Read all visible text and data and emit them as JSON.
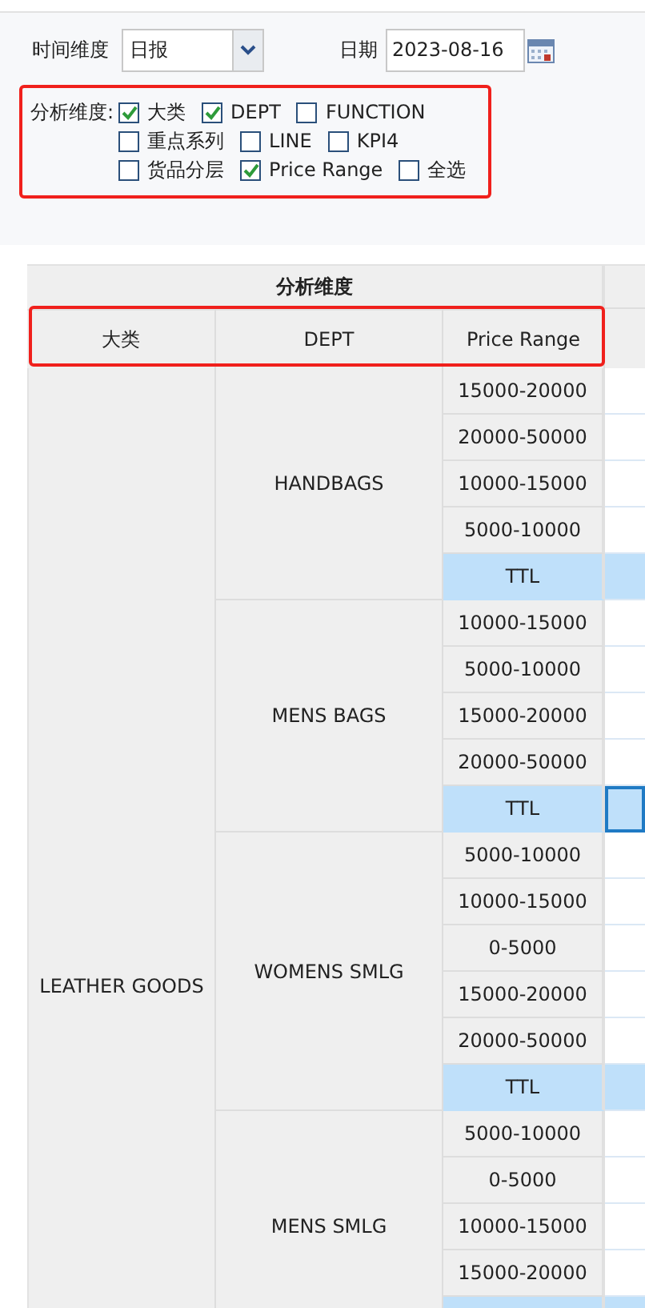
{
  "filters": {
    "period": {
      "label": "时间维度",
      "value": "日报"
    },
    "date": {
      "label": "日期",
      "value": "2023-08-16"
    }
  },
  "dimensions": {
    "label": "分析维度:",
    "option_rows": [
      [
        {
          "label": "大类",
          "checked": true
        },
        {
          "label": "DEPT",
          "checked": true
        },
        {
          "label": "FUNCTION",
          "checked": false
        }
      ],
      [
        {
          "label": "重点系列",
          "checked": false
        },
        {
          "label": "LINE",
          "checked": false
        },
        {
          "label": "KPI4",
          "checked": false
        }
      ],
      [
        {
          "label": "货品分层",
          "checked": false
        },
        {
          "label": "Price Range",
          "checked": true
        },
        {
          "label": "全选",
          "checked": false
        }
      ]
    ]
  },
  "table": {
    "group_header": "分析维度",
    "columns": [
      "大类",
      "DEPT",
      "Price Range"
    ],
    "category": "LEATHER GOODS",
    "depts": [
      {
        "name": "HANDBAGS",
        "ranges": [
          {
            "label": "15000-20000",
            "kind": "range",
            "selected": false
          },
          {
            "label": "20000-50000",
            "kind": "range",
            "selected": false
          },
          {
            "label": "10000-15000",
            "kind": "range",
            "selected": false
          },
          {
            "label": "5000-10000",
            "kind": "range",
            "selected": false
          },
          {
            "label": "TTL",
            "kind": "ttl",
            "selected": false
          }
        ]
      },
      {
        "name": "MENS BAGS",
        "ranges": [
          {
            "label": "10000-15000",
            "kind": "range",
            "selected": false
          },
          {
            "label": "5000-10000",
            "kind": "range",
            "selected": false
          },
          {
            "label": "15000-20000",
            "kind": "range",
            "selected": false
          },
          {
            "label": "20000-50000",
            "kind": "range",
            "selected": false
          },
          {
            "label": "TTL",
            "kind": "ttl",
            "selected": true
          }
        ]
      },
      {
        "name": "WOMENS SMLG",
        "ranges": [
          {
            "label": "5000-10000",
            "kind": "range",
            "selected": false
          },
          {
            "label": "10000-15000",
            "kind": "range",
            "selected": false
          },
          {
            "label": "0-5000",
            "kind": "range",
            "selected": false
          },
          {
            "label": "15000-20000",
            "kind": "range",
            "selected": false
          },
          {
            "label": "20000-50000",
            "kind": "range",
            "selected": false
          },
          {
            "label": "TTL",
            "kind": "ttl",
            "selected": false
          }
        ]
      },
      {
        "name": "MENS SMLG",
        "ranges": [
          {
            "label": "5000-10000",
            "kind": "range",
            "selected": false
          },
          {
            "label": "0-5000",
            "kind": "range",
            "selected": false
          },
          {
            "label": "10000-15000",
            "kind": "range",
            "selected": false
          },
          {
            "label": "15000-20000",
            "kind": "range",
            "selected": false
          },
          {
            "kind": "ttl",
            "selected": false
          }
        ]
      }
    ]
  }
}
